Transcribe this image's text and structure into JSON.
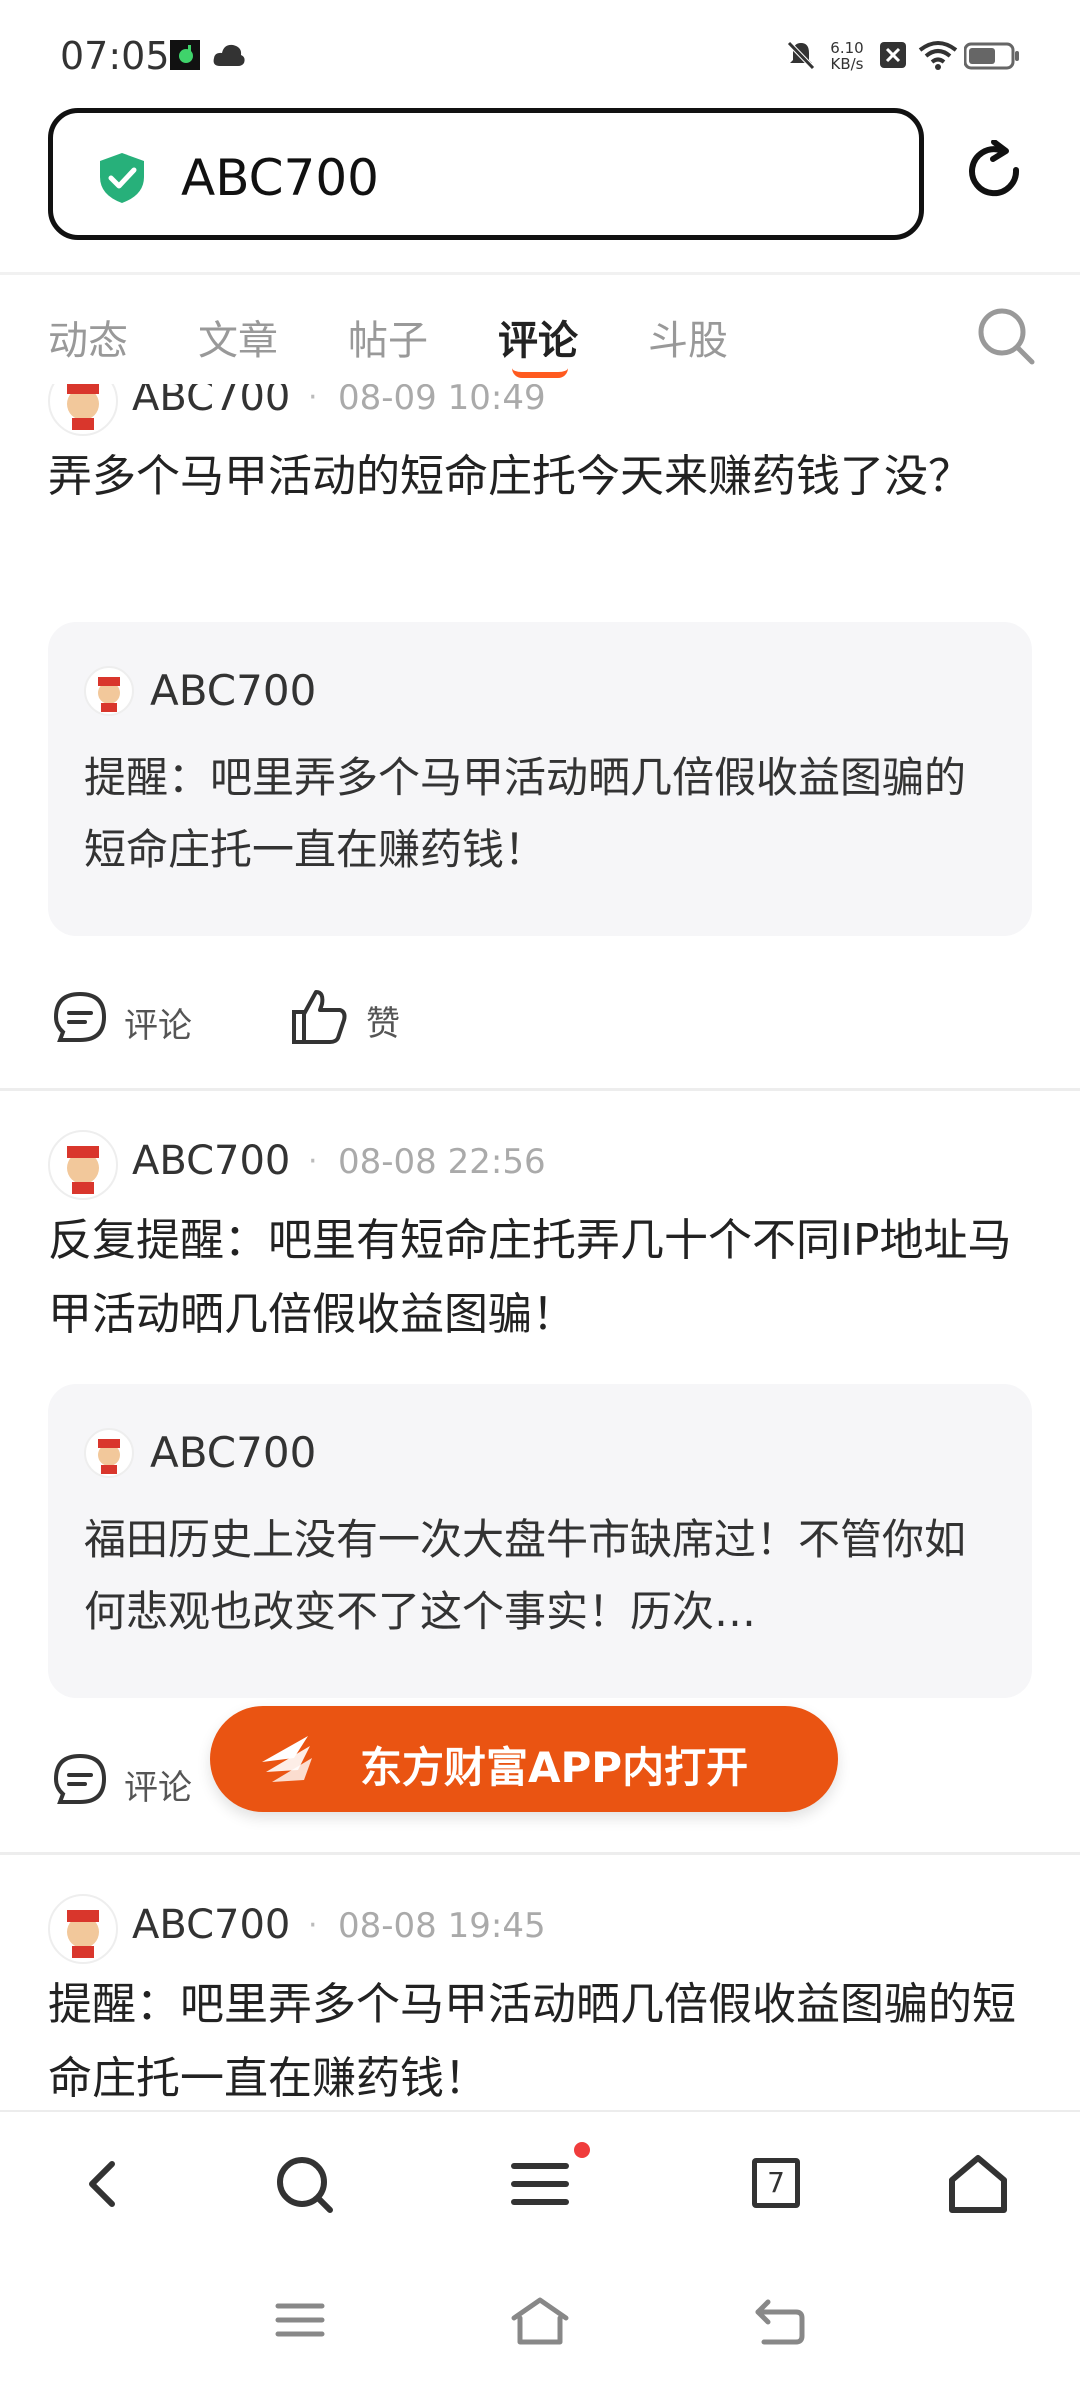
{
  "status_bar": {
    "time": "07:05",
    "net_speed_value": "6.10",
    "net_speed_unit": "KB/s",
    "icons": [
      "app-icon",
      "cloud-icon",
      "mute-icon",
      "close-box-icon",
      "wifi-icon",
      "battery-icon"
    ]
  },
  "address_bar": {
    "url": "ABC700",
    "security_icon": "shield-check-icon"
  },
  "tabs": [
    {
      "label": "动态",
      "active": false
    },
    {
      "label": "文章",
      "active": false
    },
    {
      "label": "帖子",
      "active": false
    },
    {
      "label": "评论",
      "active": true
    },
    {
      "label": "斗股",
      "active": false
    }
  ],
  "accent_color": "#ea5412",
  "posts": [
    {
      "author": "ABC700",
      "time": "08-09 10:49",
      "text": "弄多个马甲活动的短命庄托今天来赚药钱了没？",
      "quote": {
        "author": "ABC700",
        "text": "提醒：吧里弄多个马甲活动晒几倍假收益图骗的短命庄托一直在赚药钱！"
      },
      "comment_label": "评论",
      "like_label": "赞"
    },
    {
      "author": "ABC700",
      "time": "08-08 22:56",
      "text": "反复提醒：吧里有短命庄托弄几十个不同IP地址马甲活动晒几倍假收益图骗！",
      "quote": {
        "author": "ABC700",
        "text": "福田历史上没有一次大盘牛市缺席过！不管你如何悲观也改变不了这个事实！历次…"
      },
      "comment_label": "评论"
    },
    {
      "author": "ABC700",
      "time": "08-08 19:45",
      "text": "提醒：吧里弄多个马甲活动晒几倍假收益图骗的短命庄托一直在赚药钱！"
    }
  ],
  "open_app_button": {
    "label": "东方财富APP内打开"
  },
  "toolbar": {
    "tab_count": "7",
    "items": [
      "back-icon",
      "search-icon",
      "menu-icon",
      "tabs-icon",
      "home-icon"
    ]
  }
}
